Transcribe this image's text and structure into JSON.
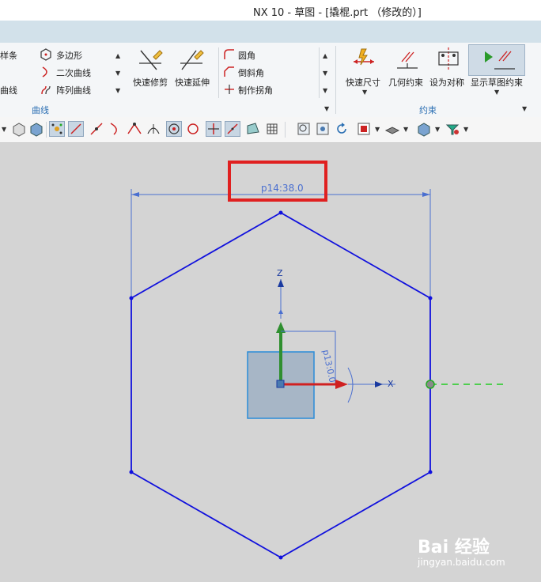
{
  "window": {
    "title": "NX 10 - 草图 - [撬棍.prt （修改的）]"
  },
  "ribbon": {
    "curve_group": {
      "items": {
        "spline": "样条",
        "curve": "曲线",
        "polygon": "多边形",
        "conic": "二次曲线",
        "pattern_curve": "阵列曲线",
        "quick_trim": "快速修剪",
        "quick_extend": "快速延伸",
        "fillet": "圆角",
        "chamfer": "倒斜角",
        "make_corner": "制作拐角"
      },
      "label": "曲线"
    },
    "constraint_group": {
      "items": {
        "rapid_dimension": "快速尺寸",
        "geometric_constraint": "几何约束",
        "make_symmetric": "设为对称",
        "show_sketch_constraints": "显示草图约束"
      },
      "label": "约束"
    }
  },
  "toolbar": {
    "icons": [
      "cube-wire-icon",
      "cube-shaded-icon",
      "snap-points-icon",
      "line-snap-icon",
      "end-point-icon",
      "curve-icon",
      "intersection-icon",
      "tangent-icon",
      "center-icon",
      "quadrant-icon",
      "cross-point-icon",
      "point-on-curve-icon",
      "face-point-icon",
      "grid-icon",
      "zoom-icon",
      "view-icon",
      "rotate-icon",
      "render-style-icon",
      "layer-icon",
      "shaded-icon",
      "filter-icon"
    ]
  },
  "canvas": {
    "dimension_top": "p14:38.0",
    "dimension_angle": "p13:0.0",
    "axis_z": "Z",
    "axis_x": "X",
    "colors": {
      "sketch": "#1010dd",
      "dimension": "#4a6fd0",
      "x_axis": "#d02020",
      "z_axis": "#2f8f2f",
      "ref_line": "#22cc22",
      "highlight": "#e02020"
    }
  },
  "watermark": {
    "brand": "Bai 经验",
    "sub": "jingyan.baidu.com"
  }
}
